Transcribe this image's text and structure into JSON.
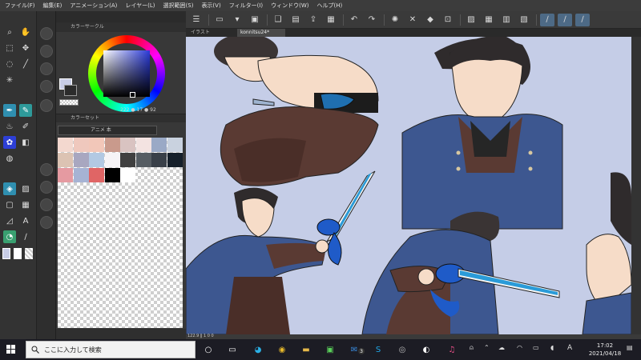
{
  "menu": [
    "ファイル(F)",
    "編集(E)",
    "アニメーション(A)",
    "レイヤー(L)",
    "選択範囲(S)",
    "表示(V)",
    "フィルター(I)",
    "ウィンドウ(W)",
    "ヘルプ(H)"
  ],
  "color_circle_panel": {
    "title": "カラーサークル",
    "hsv": "222 ● 17 ● 92"
  },
  "color_set_panel": {
    "title": "カラーセット",
    "set_name": "アニメ 本",
    "swatches": [
      "#f3d8cf",
      "#efc8bd",
      "#f2c7b9",
      "#c99a8c",
      "#d9c3c1",
      "#f3e3e1",
      "#9aa9c6",
      "#c9d2df",
      "#dcc3b3",
      "#a8a7c0",
      "#b2c9e3",
      "#f6f4f6",
      "#404040",
      "#565d63",
      "#394049",
      "#16202b",
      "#e59aa1",
      "#a6b3d4",
      "#e06565",
      "#000000",
      "#ffffff"
    ]
  },
  "canvas": {
    "tabs": [
      "イラスト",
      "konnitsu24*"
    ],
    "zoom_status": "122.9   ‖  1 0 0"
  },
  "taskbar": {
    "search_placeholder": "ここに入力して検索",
    "time": "17:02",
    "date": "2021/04/18",
    "ime": "A",
    "mail_badge": "3"
  },
  "colors": {
    "canvas_bg": "#c5cde7",
    "accent": "#2f8fb0",
    "coat": "#3d5790",
    "pants": "#5a3a33",
    "blade": "#2a9bd8"
  }
}
